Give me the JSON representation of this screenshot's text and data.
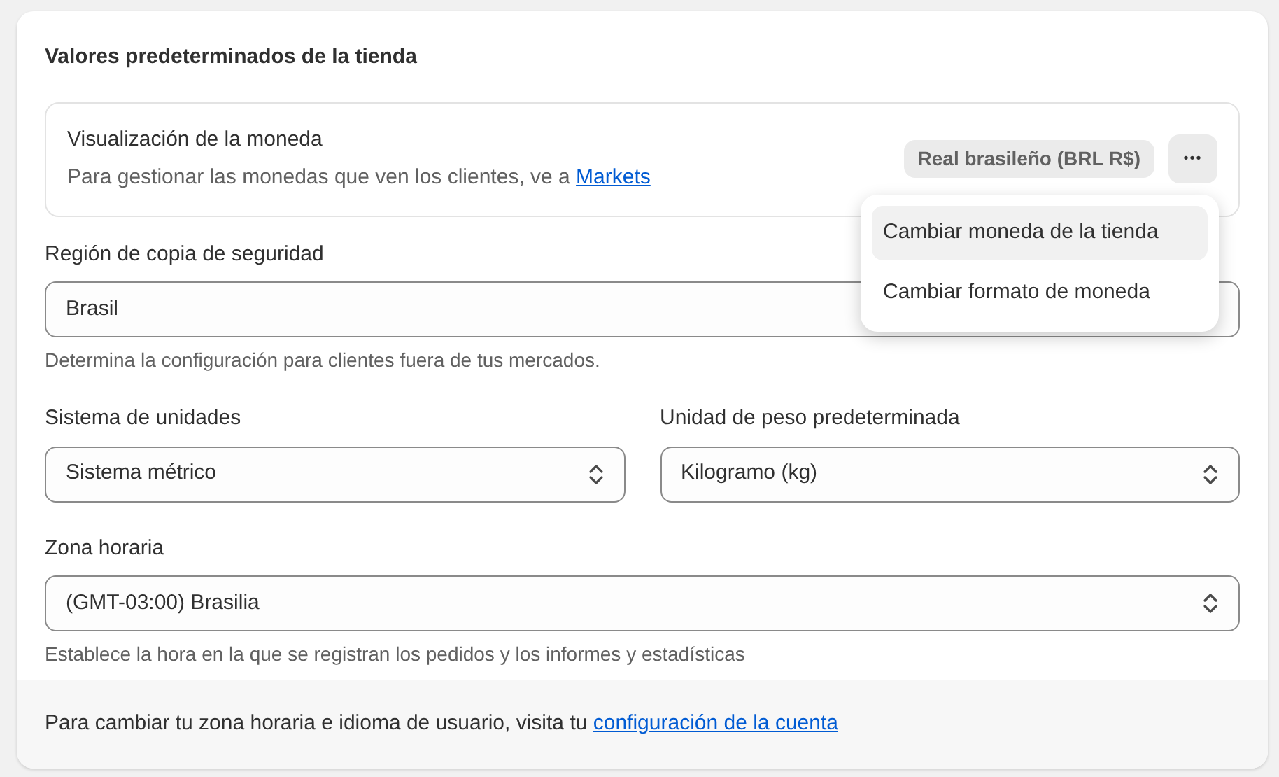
{
  "card": {
    "title": "Valores predeterminados de la tienda"
  },
  "currency": {
    "title": "Visualización de la moneda",
    "description": "Para gestionar las monedas que ven los clientes, ve a ",
    "link": "Markets",
    "badge": "Real brasileño (BRL R$)",
    "more_button": "•••"
  },
  "menu": {
    "items": [
      {
        "label": "Cambiar moneda de la tienda",
        "selected": true
      },
      {
        "label": "Cambiar formato de moneda",
        "selected": false
      }
    ]
  },
  "backup_region": {
    "label": "Región de copia de seguridad",
    "value": "Brasil",
    "help": "Determina la configuración para clientes fuera de tus mercados."
  },
  "unit_system": {
    "label": "Sistema de unidades",
    "value": "Sistema métrico"
  },
  "weight_unit": {
    "label": "Unidad de peso predeterminada",
    "value": "Kilogramo (kg)"
  },
  "timezone": {
    "label": "Zona horaria",
    "value": "(GMT-03:00) Brasilia",
    "help": "Establece la hora en la que se registran los pedidos y los informes y estadísticas"
  },
  "footer": {
    "text": "Para cambiar tu zona horaria e idioma de usuario, visita tu ",
    "link": "configuración de la cuenta"
  }
}
